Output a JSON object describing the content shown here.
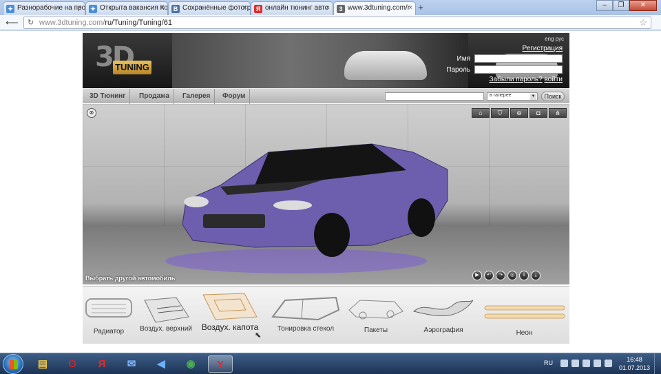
{
  "browser": {
    "tabs": [
      {
        "title": "Разнорабочие на про",
        "color": "#4a8fd8",
        "glyph": "✦",
        "active": false
      },
      {
        "title": "Открыта вакансия Ко",
        "color": "#4a8fd8",
        "glyph": "✦",
        "active": false
      },
      {
        "title": "Сохранённые фотогр",
        "color": "#4c75a3",
        "glyph": "В",
        "active": false
      },
      {
        "title": "онлайн тюнинг авто",
        "color": "#e32b2b",
        "glyph": "Я",
        "active": false
      },
      {
        "title": "www.3dtuning.com/r",
        "color": "#666666",
        "glyph": "3",
        "active": true
      }
    ],
    "url_host": "www.3dtuning.com/",
    "url_path": "ru/Tuning/Tuning/61",
    "new_tab_glyph": "+",
    "window_buttons": [
      "‒",
      "❐",
      "✕"
    ]
  },
  "site": {
    "logo_3d": "3D",
    "logo_tuning": "TUNING",
    "lang_switch": "eng рус",
    "register_link": "Регистрация",
    "name_label": "Имя",
    "password_label": "Пароль",
    "forgot_link": "Забыли пароль?",
    "login_link": "войти",
    "nav": [
      "3D Тюнинг",
      "Продажа",
      "Галерея",
      "Форум"
    ],
    "search_scope": "в галерее",
    "search_button": "Поиск",
    "choose_other_car": "Выбрать другой автомобиль",
    "accent_car_color": "#6e5fae",
    "categories": [
      {
        "label": "Радиатор",
        "selected": false
      },
      {
        "label": "Воздух. верхний",
        "selected": false
      },
      {
        "label": "Воздух. капота",
        "selected": true
      },
      {
        "label": "Тонировка стекол",
        "selected": false
      },
      {
        "label": "Пакеты",
        "selected": false
      },
      {
        "label": "Аэрография",
        "selected": false
      },
      {
        "label": "Неон",
        "selected": false
      }
    ]
  },
  "taskbar": {
    "pinned": [
      {
        "name": "explorer",
        "glyph": "▤",
        "color": "#f2c94c"
      },
      {
        "name": "opera",
        "glyph": "O",
        "color": "#e11d1d"
      },
      {
        "name": "yandex",
        "glyph": "Я",
        "color": "#e32b2b"
      },
      {
        "name": "mail",
        "glyph": "✉",
        "color": "#7fb6ff"
      },
      {
        "name": "media",
        "glyph": "◀",
        "color": "#6ab0ff"
      },
      {
        "name": "chrome",
        "glyph": "◉",
        "color": "#4caf50"
      },
      {
        "name": "yandex-browser",
        "glyph": "Y",
        "color": "#e32b2b"
      }
    ],
    "lang": "RU",
    "time": "16:48",
    "date": "01.07.2013"
  }
}
